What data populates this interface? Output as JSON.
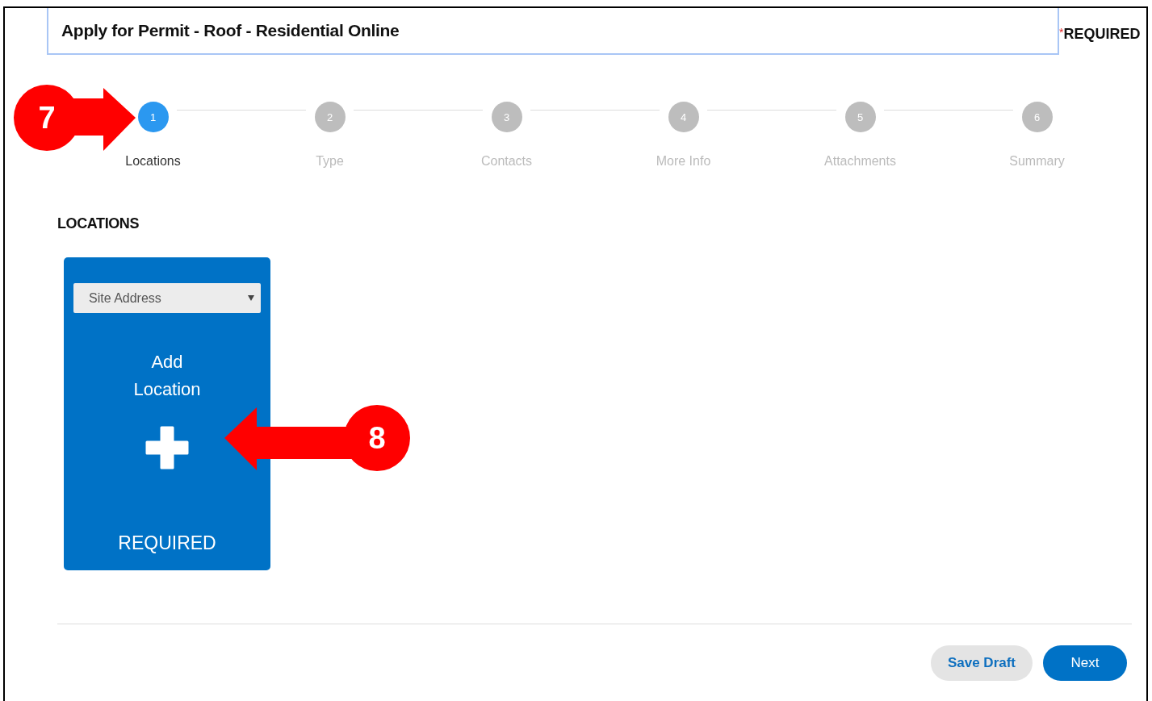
{
  "header": {
    "title": "Apply for Permit - Roof - Residential Online",
    "required_marker": "*",
    "required_label": "REQUIRED"
  },
  "steps": [
    {
      "number": "1",
      "label": "Locations",
      "selected": true
    },
    {
      "number": "2",
      "label": "Type",
      "selected": false
    },
    {
      "number": "3",
      "label": "Contacts",
      "selected": false
    },
    {
      "number": "4",
      "label": "More Info",
      "selected": false
    },
    {
      "number": "5",
      "label": "Attachments",
      "selected": false
    },
    {
      "number": "6",
      "label": "Summary",
      "selected": false
    }
  ],
  "section_title": "LOCATIONS",
  "location_card": {
    "dropdown": {
      "value": "Site Address"
    },
    "title": "Add Location",
    "status": "REQUIRED"
  },
  "buttons": [
    {
      "kind": "secondary",
      "label": "Save Draft"
    },
    {
      "kind": "primary",
      "label": "Next"
    }
  ],
  "callouts": [
    {
      "number": "7",
      "kind": "right"
    },
    {
      "number": "8",
      "kind": "left"
    }
  ]
}
